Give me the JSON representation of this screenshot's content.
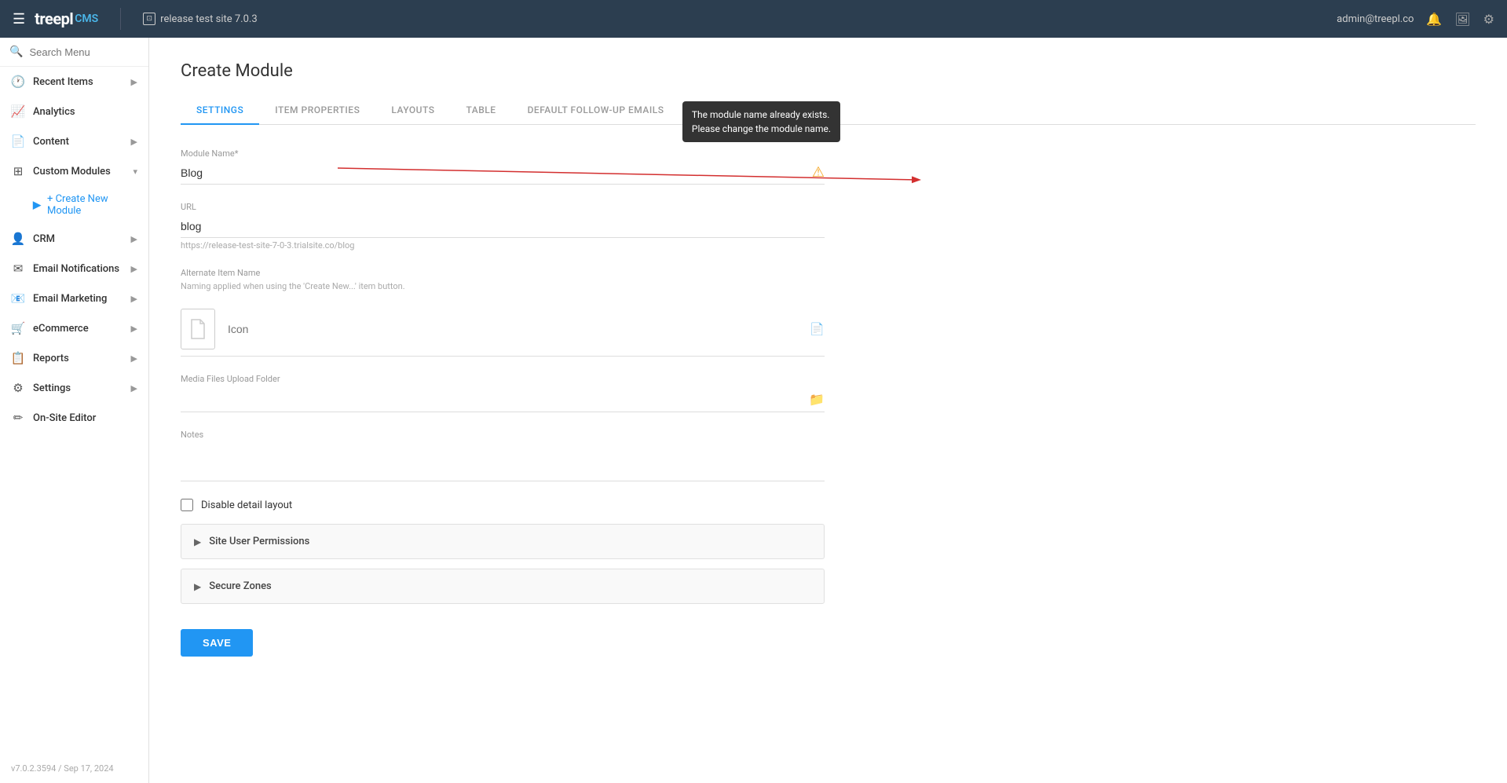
{
  "topbar": {
    "hamburger": "☰",
    "logo_text": "treepl",
    "logo_cms": "CMS",
    "site_name": "release test site 7.0.3",
    "admin_email": "admin@treepl.co"
  },
  "sidebar": {
    "search_placeholder": "Search Menu",
    "nav_items": [
      {
        "id": "recent-items",
        "label": "Recent Items",
        "icon": "🕐",
        "has_arrow": true
      },
      {
        "id": "analytics",
        "label": "Analytics",
        "icon": "📈",
        "has_arrow": false
      },
      {
        "id": "content",
        "label": "Content",
        "icon": "📄",
        "has_arrow": true
      },
      {
        "id": "custom-modules",
        "label": "Custom Modules",
        "icon": "⊞",
        "has_arrow": true
      },
      {
        "id": "crm",
        "label": "CRM",
        "icon": "👤",
        "has_arrow": true
      },
      {
        "id": "email-notifications",
        "label": "Email Notifications",
        "icon": "✉",
        "has_arrow": true
      },
      {
        "id": "email-marketing",
        "label": "Email Marketing",
        "icon": "📧",
        "has_arrow": true
      },
      {
        "id": "ecommerce",
        "label": "eCommerce",
        "icon": "🛒",
        "has_arrow": true
      },
      {
        "id": "reports",
        "label": "Reports",
        "icon": "📋",
        "has_arrow": true
      },
      {
        "id": "settings",
        "label": "Settings",
        "icon": "⚙",
        "has_arrow": true
      },
      {
        "id": "on-site-editor",
        "label": "On-Site Editor",
        "icon": "✏",
        "has_arrow": false
      }
    ],
    "sub_items": [
      {
        "id": "create-new-module",
        "label": "+ Create New Module",
        "active": true
      }
    ],
    "version": "v7.0.2.3594 / Sep 17, 2024"
  },
  "page": {
    "title": "Create Module",
    "tabs": [
      {
        "id": "settings",
        "label": "SETTINGS",
        "active": true
      },
      {
        "id": "item-properties",
        "label": "ITEM PROPERTIES",
        "active": false
      },
      {
        "id": "layouts",
        "label": "LAYOUTS",
        "active": false
      },
      {
        "id": "table",
        "label": "TABLE",
        "active": false
      },
      {
        "id": "default-follow-up-emails",
        "label": "DEFAULT FOLLOW-UP EMAILS",
        "active": false
      }
    ]
  },
  "form": {
    "module_name_label": "Module Name*",
    "module_name_value": "Blog",
    "url_label": "URL",
    "url_value": "blog",
    "url_hint": "https://release-test-site-7-0-3.trialsite.co/blog",
    "alternate_item_name_label": "Alternate Item Name",
    "alternate_item_name_hint": "Naming applied when using the 'Create New...' item button.",
    "icon_label": "Icon",
    "media_folder_label": "Media Files Upload Folder",
    "notes_label": "Notes",
    "disable_detail_layout_label": "Disable detail layout",
    "site_user_permissions_label": "Site User Permissions",
    "secure_zones_label": "Secure Zones",
    "save_button_label": "SAVE"
  },
  "tooltip": {
    "line1": "The module name already exists.",
    "line2": "Please change the module name."
  },
  "colors": {
    "primary": "#2196f3",
    "topbar_bg": "#2c3e50",
    "warning": "#f5a623",
    "error_arrow": "#d32f2f"
  }
}
